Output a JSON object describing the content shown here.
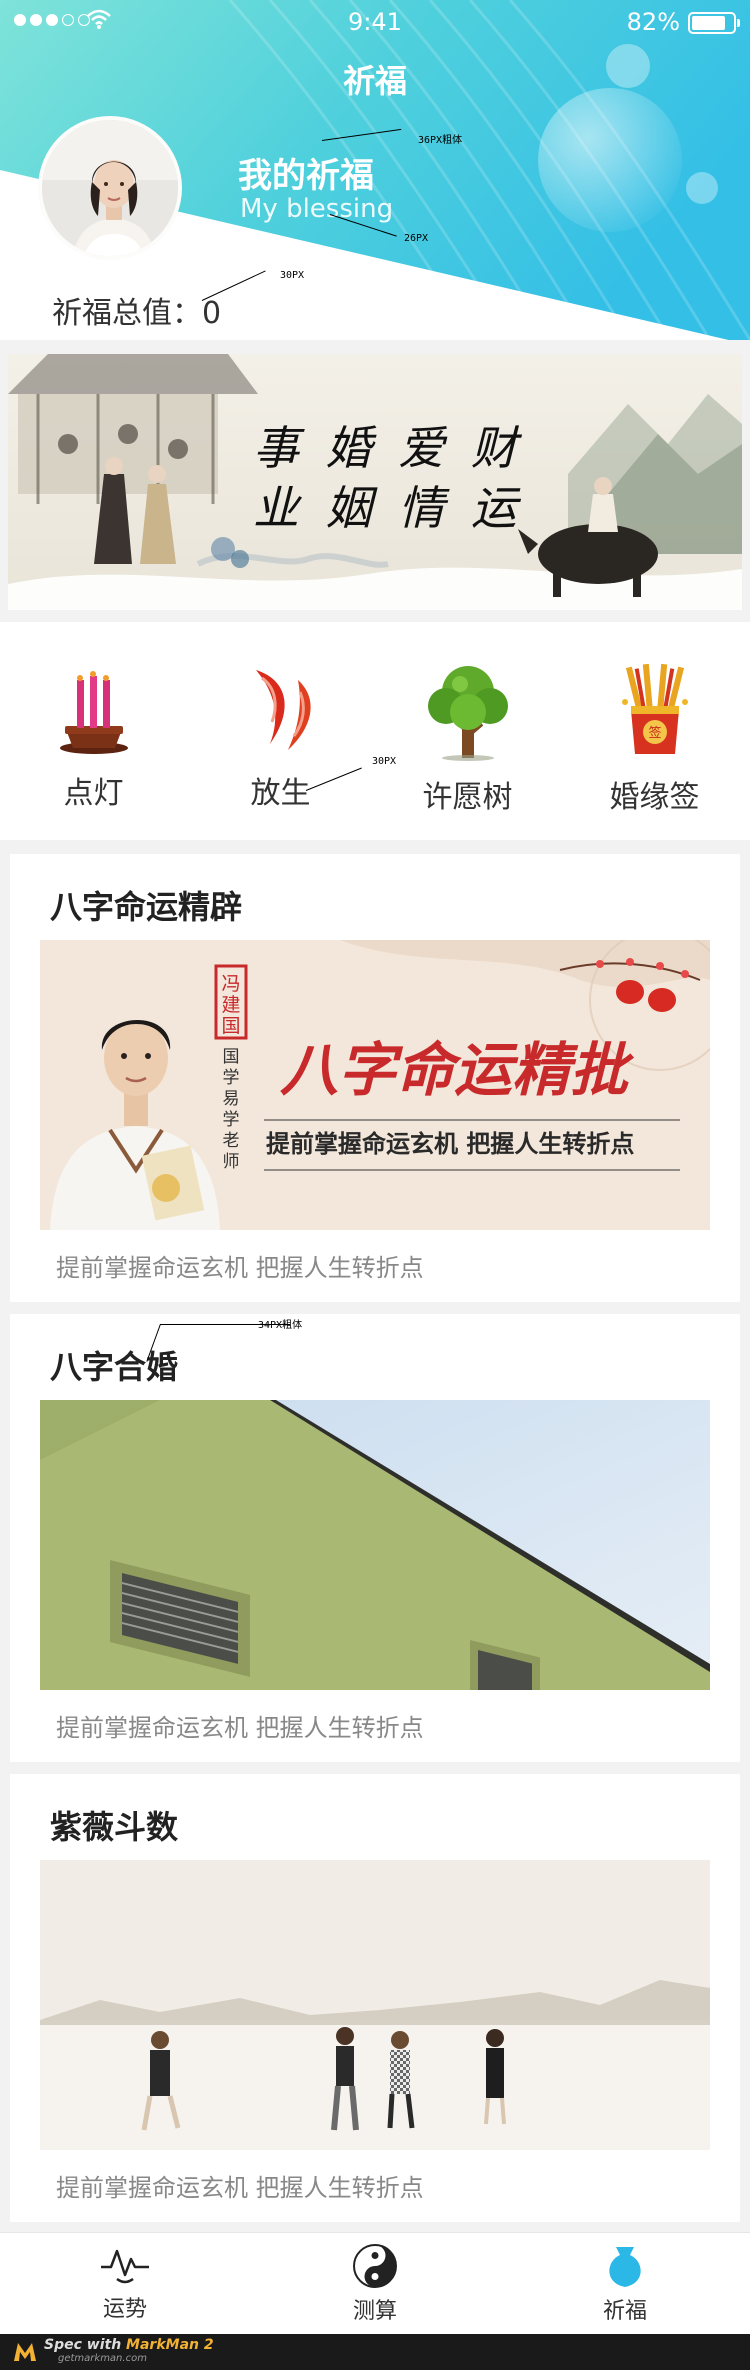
{
  "status_bar": {
    "time": "9:41",
    "battery_pct_text": "82%",
    "battery_level": 0.82
  },
  "header": {
    "nav_title": "祈福",
    "my_title": "我的祈福",
    "my_subtitle": "My blessing",
    "total_label": "祈福总值：",
    "total_value": "0",
    "gradient_start": "#6fe0d6",
    "gradient_end": "#37c3e8"
  },
  "spec_notes": {
    "title_note": "36PX粗体",
    "subtitle_note": "26PX",
    "total_note": "30PX",
    "icon_note": "30PX",
    "card_note": "34PX粗体"
  },
  "banner": {
    "calligraphy_row1": "事 婚 爱 财",
    "calligraphy_row2": "业 姻 情 运"
  },
  "icon_row": [
    {
      "label": "点灯",
      "icon": "incense-icon"
    },
    {
      "label": "放生",
      "icon": "koi-fish-icon"
    },
    {
      "label": "许愿树",
      "icon": "wish-tree-icon"
    },
    {
      "label": "婚缘签",
      "icon": "marriage-lot-icon"
    }
  ],
  "cards": [
    {
      "title": "八字命运精辟",
      "description": "提前掌握命运玄机 把握人生转折点",
      "poster": {
        "name_seal": "冯建国",
        "vertical_caption": "国学易学老师",
        "headline": "八字命运精批",
        "tagline": "提前掌握命运玄机 把握人生转折点"
      }
    },
    {
      "title": "八字合婚",
      "description": "提前掌握命运玄机 把握人生转折点"
    },
    {
      "title": "紫薇斗数",
      "description": "提前掌握命运玄机 把握人生转折点"
    }
  ],
  "tabbar": [
    {
      "label": "运势",
      "icon": "pulse-icon",
      "active": false
    },
    {
      "label": "测算",
      "icon": "yin-yang-icon",
      "active": false
    },
    {
      "label": "祈福",
      "icon": "blessing-bag-icon",
      "active": true
    }
  ],
  "markman": {
    "text_prefix": "Spec with ",
    "text_brand": "MarkMan 2",
    "url": "getmarkman.com"
  },
  "colors": {
    "accent": "#2bb8e6",
    "teal": "#5fd9d2",
    "seal_red": "#c8292b",
    "text_dark": "#333333",
    "text_muted": "#888888"
  }
}
